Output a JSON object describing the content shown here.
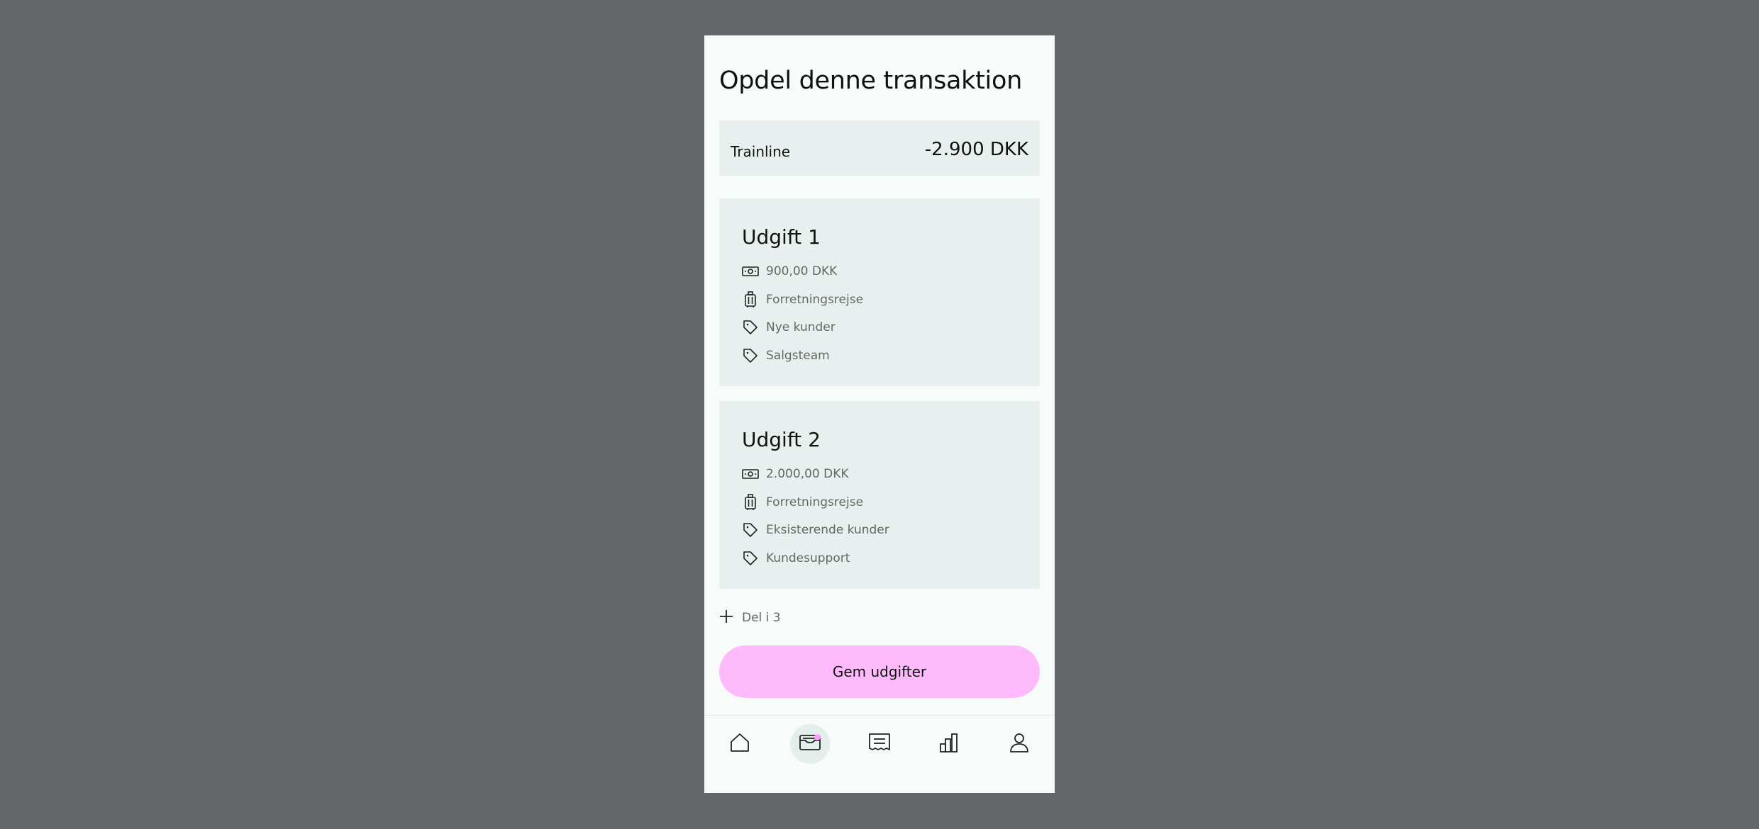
{
  "page": {
    "title": "Opdel denne transaktion"
  },
  "transaction": {
    "merchant": "Trainline",
    "amount": "-2.900 DKK"
  },
  "expenses": [
    {
      "title": "Udgift 1",
      "amount": "900,00 DKK",
      "category": "Forretningsrejse",
      "tag1": "Nye kunder",
      "tag2": "Salgsteam"
    },
    {
      "title": "Udgift 2",
      "amount": "2.000,00 DKK",
      "category": "Forretningsrejse",
      "tag1": "Eksisterende kunder",
      "tag2": "Kundesupport"
    }
  ],
  "actions": {
    "add_split_label": "Del i 3",
    "save_label": "Gem udgifter"
  },
  "nav": {
    "items": [
      {
        "icon": "home-icon",
        "active": false
      },
      {
        "icon": "inbox-icon",
        "active": true,
        "has_notification": true
      },
      {
        "icon": "receipt-icon",
        "active": false
      },
      {
        "icon": "chart-icon",
        "active": false
      },
      {
        "icon": "profile-icon",
        "active": false
      }
    ]
  },
  "colors": {
    "background": "#636767",
    "screen": "#f7fbfa",
    "card": "#e8f0ef",
    "accent": "#ffbafc",
    "notification_dot": "#ff9df4"
  }
}
